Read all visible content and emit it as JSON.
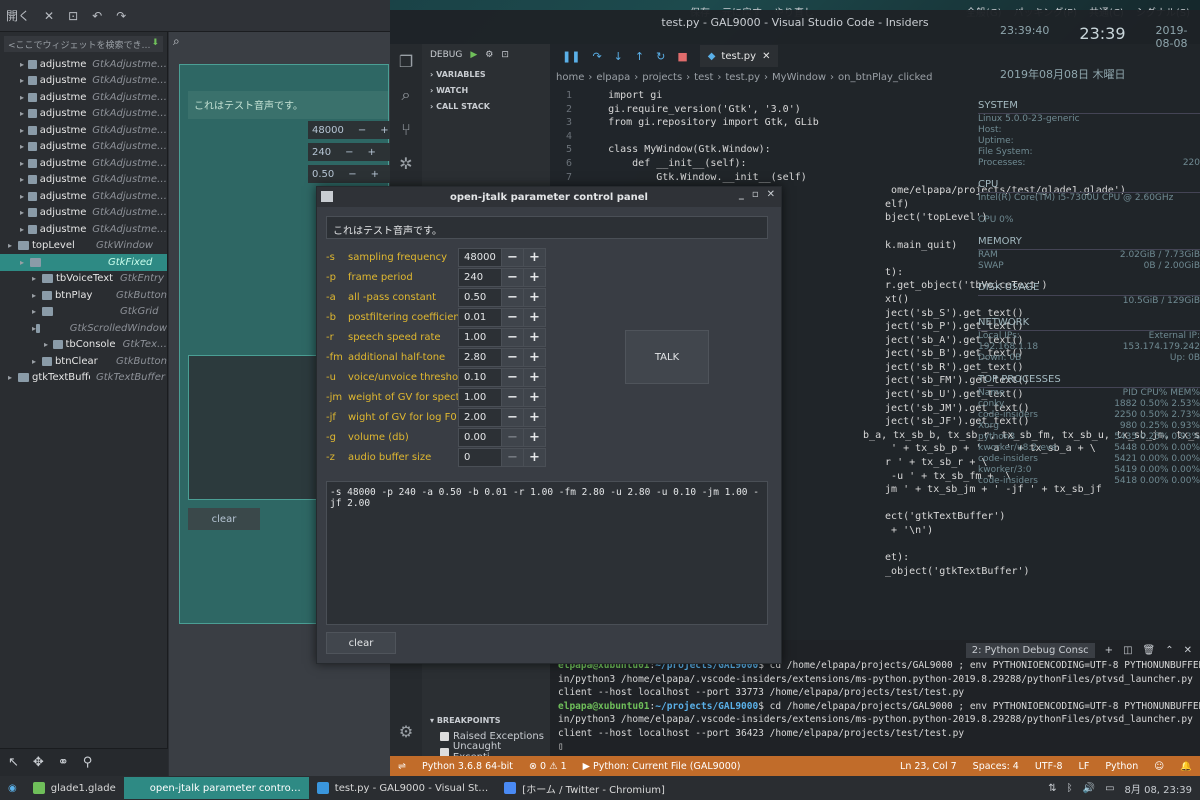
{
  "glade": {
    "toolbar": {
      "open_label": "開く"
    },
    "search_placeholder": "<ここでウィジェットを検索でき…",
    "tree": [
      {
        "name": "adjustment1",
        "type": "GtkAdjustme…",
        "indent": 1
      },
      {
        "name": "adjustment10",
        "type": "GtkAdjustme…",
        "indent": 1
      },
      {
        "name": "adjustment11",
        "type": "GtkAdjustme…",
        "indent": 1
      },
      {
        "name": "adjustment2",
        "type": "GtkAdjustme…",
        "indent": 1
      },
      {
        "name": "adjustment3",
        "type": "GtkAdjustme…",
        "indent": 1
      },
      {
        "name": "adjustment4",
        "type": "GtkAdjustme…",
        "indent": 1
      },
      {
        "name": "adjustment5",
        "type": "GtkAdjustme…",
        "indent": 1
      },
      {
        "name": "adjustment6",
        "type": "GtkAdjustme…",
        "indent": 1
      },
      {
        "name": "adjustment7",
        "type": "GtkAdjustme…",
        "indent": 1
      },
      {
        "name": "adjustment8",
        "type": "GtkAdjustme…",
        "indent": 1
      },
      {
        "name": "adjustment9",
        "type": "GtkAdjustme…",
        "indent": 1
      },
      {
        "name": "topLevel",
        "type": "GtkWindow",
        "indent": 0
      },
      {
        "name": "",
        "type": "GtkFixed",
        "indent": 1,
        "selected": true
      },
      {
        "name": "tbVoiceText",
        "type": "GtkEntry",
        "indent": 2
      },
      {
        "name": "btnPlay",
        "type": "GtkButton",
        "indent": 2
      },
      {
        "name": "",
        "type": "GtkGrid",
        "indent": 2
      },
      {
        "name": "",
        "type": "GtkScrolledWindow",
        "indent": 2
      },
      {
        "name": "tbConsole",
        "type": "GtkTex…",
        "indent": 3
      },
      {
        "name": "btnClear",
        "type": "GtkButton",
        "indent": 2
      },
      {
        "name": "gtkTextBuffer",
        "type": "GtkTextBuffer",
        "indent": 0
      }
    ],
    "canvas": {
      "voice_text": "これはテスト音声です。",
      "spin_values": [
        "48000",
        "240",
        "0.50"
      ],
      "clear_label": "clear"
    }
  },
  "top_panel": {
    "left_items": [
      "保存",
      "元に戻す",
      "やり直し"
    ],
    "right_items": [
      "全般(G)",
      "パッキング(P)",
      "共通(C)",
      "シグナル(S)"
    ]
  },
  "conky": {
    "time_small": "23:39:40",
    "time_big": "23:39",
    "date_right": "2019-08-08",
    "date_long": "2019年08月08日 木曜日",
    "sections": [
      {
        "title": "SYSTEM",
        "rows": [
          [
            "Linux 5.0.0-23-generic",
            ""
          ],
          [
            "Host:",
            ""
          ],
          [
            "Uptime:",
            ""
          ],
          [
            "File System:",
            ""
          ],
          [
            "Processes:",
            "220"
          ]
        ]
      },
      {
        "title": "CPU",
        "rows": [
          [
            "Intel(R) Core(TM) i5-7300U CPU @ 2.60GHz",
            ""
          ],
          [
            "",
            ""
          ],
          [
            "CPU 0%",
            ""
          ]
        ]
      },
      {
        "title": "MEMORY",
        "rows": [
          [
            "RAM",
            "2.02GiB / 7.73GiB"
          ],
          [
            "SWAP",
            "0B / 2.00GiB"
          ]
        ]
      },
      {
        "title": "DISK USAGE",
        "rows": [
          [
            "",
            "10.5GiB / 129GiB"
          ]
        ]
      },
      {
        "title": "NETWORK",
        "rows": [
          [
            "Local IPs:",
            "External IP:"
          ],
          [
            "192.168.1.18",
            "153.174.179.242"
          ],
          [
            "Down: 0B",
            "Up: 0B"
          ]
        ]
      },
      {
        "title": "TOP PROCESSES",
        "rows": [
          [
            "Name",
            "PID  CPU%  MEM%"
          ],
          [
            "conky",
            "1882  0.50%  2.53%"
          ],
          [
            "code-insiders",
            "2250  0.50%  2.73%"
          ],
          [
            "Xorg",
            "980  0.25%  0.93%"
          ],
          [
            "python3",
            "5435  0.25%  0.93%"
          ],
          [
            "kworker/u8:2-eve",
            "5448  0.00%  0.00%"
          ],
          [
            "code-insiders",
            "5421  0.00%  0.00%"
          ],
          [
            "kworker/3:0",
            "5419  0.00%  0.00%"
          ],
          [
            "code-insiders",
            "5418  0.00%  0.00%"
          ]
        ]
      }
    ]
  },
  "vscode": {
    "title": "test.py - GAL9000 - Visual Studio Code - Insiders",
    "debug_label": "DEBUG",
    "sidebar_sections": [
      "VARIABLES",
      "WATCH",
      "CALL STACK"
    ],
    "breakpoints_label": "BREAKPOINTS",
    "breakpoints": [
      "Raised Exceptions",
      "Uncaught Excepti…"
    ],
    "tab_label": "test.py",
    "breadcrumb": [
      "home",
      "elpapa",
      "projects",
      "test",
      "test.py",
      "MyWindow",
      "on_btnPlay_clicked"
    ],
    "code_lines": [
      {
        "n": "1",
        "t": "    import gi"
      },
      {
        "n": "2",
        "t": "    gi.require_version('Gtk', '3.0')"
      },
      {
        "n": "3",
        "t": "    from gi.repository import Gtk, GLib"
      },
      {
        "n": "4",
        "t": ""
      },
      {
        "n": "5",
        "t": "    class MyWindow(Gtk.Window):"
      },
      {
        "n": "6",
        "t": "        def __init__(self):"
      },
      {
        "n": "7",
        "t": "            Gtk.Window.__init__(self)"
      },
      {
        "n": "",
        "t": "                                                   ome/elpapa/projects/test/glade1.glade')"
      },
      {
        "n": "",
        "t": "                                                  elf)"
      },
      {
        "n": "",
        "t": "                                                  bject('topLevel')"
      },
      {
        "n": "",
        "t": ""
      },
      {
        "n": "",
        "t": "                                                  k.main_quit)"
      },
      {
        "n": "",
        "t": ""
      },
      {
        "n": "",
        "t": "                                                  t):"
      },
      {
        "n": "",
        "t": "                                                  r.get_object('tbVoiceText')"
      },
      {
        "n": "",
        "t": "                                                  xt()"
      },
      {
        "n": "",
        "t": "                                                  ject('sb_S').get_text()"
      },
      {
        "n": "",
        "t": "                                                  ject('sb_P').get_text()"
      },
      {
        "n": "",
        "t": "                                                  ject('sb_A').get_text()"
      },
      {
        "n": "",
        "t": "                                                  ject('sb_B').get_text()"
      },
      {
        "n": "",
        "t": "                                                  ject('sb_R').get_text()"
      },
      {
        "n": "",
        "t": "                                                  ject('sb_FM').get_text()"
      },
      {
        "n": "",
        "t": "                                                  ject('sb_U').get_text()"
      },
      {
        "n": "",
        "t": "                                                  ject('sb_JM').get_text()"
      },
      {
        "n": "",
        "t": "                                                  ject('sb_JF').get_text()"
      },
      {
        "n": "",
        "t": "                                                  b_a, tx_sb_b, tx_sb_r, tx_sb_fm, tx_sb_u, tx_sb_jm, tx_sb_jf)"
      },
      {
        "n": "",
        "t": "                                                   ' + tx_sb_p + ' -a ' + tx_sb_a + \\"
      },
      {
        "n": "",
        "t": "                                                  r ' + tx_sb_r + \\"
      },
      {
        "n": "",
        "t": "                                                   -u ' + tx_sb_fm +  \\"
      },
      {
        "n": "",
        "t": "                                                  jm ' + tx_sb_jm + ' -jf ' + tx_sb_jf"
      },
      {
        "n": "",
        "t": ""
      },
      {
        "n": "",
        "t": "                                                  ect('gtkTextBuffer')"
      },
      {
        "n": "",
        "t": "                                                   + '\\n')"
      },
      {
        "n": "",
        "t": ""
      },
      {
        "n": "",
        "t": "                                                  et):"
      },
      {
        "n": "",
        "t": "                                                  _object('gtkTextBuffer')"
      }
    ],
    "terminal_select": "2: Python Debug Consc",
    "terminal_lines": [
      {
        "prompt": "elpapa@xubuntu01",
        "path": "~/projects/GAL9000",
        "cmd": "$ cd /home/elpapa/projects/GAL9000 ; env PYTHONIOENCODING=UTF-8 PYTHONUNBUFFERED=1 /usr/b"
      },
      {
        "prompt": "",
        "path": "",
        "cmd": "in/python3 /home/elpapa/.vscode-insiders/extensions/ms-python.python-2019.8.29288/pythonFiles/ptvsd_launcher.py --default --"
      },
      {
        "prompt": "",
        "path": "",
        "cmd": "client --host localhost --port 33773 /home/elpapa/projects/test/test.py"
      },
      {
        "prompt": "elpapa@xubuntu01",
        "path": "~/projects/GAL9000",
        "cmd": "$ cd /home/elpapa/projects/GAL9000 ; env PYTHONIOENCODING=UTF-8 PYTHONUNBUFFERED=1 /usr/b"
      },
      {
        "prompt": "",
        "path": "",
        "cmd": "in/python3 /home/elpapa/.vscode-insiders/extensions/ms-python.python-2019.8.29288/pythonFiles/ptvsd_launcher.py --default --"
      },
      {
        "prompt": "",
        "path": "",
        "cmd": "client --host localhost --port 36423 /home/elpapa/projects/test/test.py"
      }
    ],
    "status": {
      "python": "Python 3.6.8 64-bit",
      "problems": "⊗ 0 ⚠ 1",
      "run": "▶ Python: Current File (GAL9000)",
      "position": "Ln 23, Col 7",
      "spaces": "Spaces: 4",
      "encoding": "UTF-8",
      "eol": "LF",
      "lang": "Python"
    }
  },
  "dialog": {
    "title": "open-jtalk parameter control panel",
    "voice_text": "これはテスト音声です。",
    "params": [
      {
        "flag": "-s",
        "desc": "sampling frequency",
        "value": "48000",
        "minus_disabled": false
      },
      {
        "flag": "-p",
        "desc": "frame period",
        "value": "240",
        "minus_disabled": false
      },
      {
        "flag": "-a",
        "desc": "all -pass constant",
        "value": "0.50",
        "minus_disabled": false
      },
      {
        "flag": "-b",
        "desc": "postfiltering coefficient",
        "value": "0.01",
        "minus_disabled": false
      },
      {
        "flag": "-r",
        "desc": "speech speed rate",
        "value": "1.00",
        "minus_disabled": false
      },
      {
        "flag": "-fm",
        "desc": "additional half-tone",
        "value": "2.80",
        "minus_disabled": false
      },
      {
        "flag": "-u",
        "desc": "voice/unvoice threshold",
        "value": "0.10",
        "minus_disabled": false
      },
      {
        "flag": "-jm",
        "desc": "weight of GV for spectrum",
        "value": "1.00",
        "minus_disabled": false
      },
      {
        "flag": "-jf",
        "desc": "wight of GV for log F0",
        "value": "2.00",
        "minus_disabled": false
      },
      {
        "flag": "-g",
        "desc": "volume (db)",
        "value": "0.00",
        "minus_disabled": true
      },
      {
        "flag": "-z",
        "desc": "audio buffer size",
        "value": "0",
        "minus_disabled": true
      }
    ],
    "talk_label": "TALK",
    "console_text": "-s 48000 -p 240 -a 0.50 -b 0.01 -r 1.00 -fm 2.80 -u 2.80 -u 0.10 -jm 1.00 -jf 2.00",
    "clear_label": "clear"
  },
  "taskbar": {
    "tasks": [
      {
        "label": "glade1.glade",
        "active": false,
        "color": "#6fbf5a"
      },
      {
        "label": "open-jtalk parameter contro…",
        "active": true,
        "color": "#2e8a84"
      },
      {
        "label": "test.py - GAL9000 - Visual St…",
        "active": false,
        "color": "#3a96dd"
      },
      {
        "label": "[ホーム / Twitter - Chromium]",
        "active": false,
        "color": "#4a8af4"
      }
    ],
    "clock": "8月 08, 23:39"
  }
}
